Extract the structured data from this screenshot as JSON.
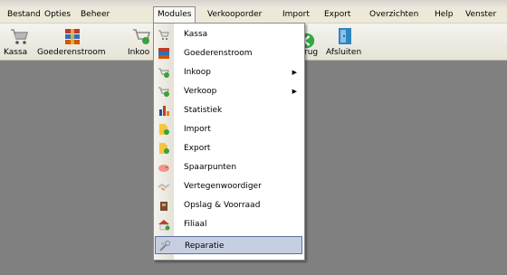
{
  "menubar": {
    "items": [
      "Bestand",
      "Opties",
      "Beheer",
      "Modules",
      "Verkooporder",
      "Import",
      "Export",
      "Overzichten",
      "Help",
      "Venster"
    ]
  },
  "toolbar": {
    "items": [
      {
        "label": "Kassa",
        "icon": "cart-icon"
      },
      {
        "label": "Goederenstroom",
        "icon": "boxes-icon"
      },
      {
        "label": "Inkoo",
        "icon": "cart-green-icon"
      },
      {
        "label": "rug",
        "icon": "back-arrow-icon"
      },
      {
        "label": "Afsluiten",
        "icon": "exit-door-icon"
      }
    ]
  },
  "modules_menu": {
    "items": [
      {
        "label": "Kassa",
        "icon": "cart-icon",
        "submenu": false
      },
      {
        "label": "Goederenstroom",
        "icon": "boxes-icon",
        "submenu": false
      },
      {
        "label": "Inkoop",
        "icon": "cart-green-icon",
        "submenu": true
      },
      {
        "label": "Verkoop",
        "icon": "cart-green-icon",
        "submenu": true
      },
      {
        "label": "Statistiek",
        "icon": "bar-chart-icon",
        "submenu": false
      },
      {
        "label": "Import",
        "icon": "import-doc-icon",
        "submenu": false
      },
      {
        "label": "Export",
        "icon": "export-doc-icon",
        "submenu": false
      },
      {
        "label": "Spaarpunten",
        "icon": "piggy-bank-icon",
        "submenu": false
      },
      {
        "label": "Vertegenwoordiger",
        "icon": "handshake-icon",
        "submenu": false
      },
      {
        "label": "Opslag & Voorraad",
        "icon": "warehouse-icon",
        "submenu": false
      },
      {
        "label": "Filiaal",
        "icon": "house-icon",
        "submenu": false
      },
      {
        "label": "Reparatie",
        "icon": "tools-icon",
        "submenu": false,
        "highlighted": true
      }
    ],
    "submenu_glyph": "▶"
  },
  "colors": {
    "workspace": "#808080",
    "menubar": "#ece9d8",
    "highlight": "#c6cfe2",
    "highlight_border": "#5c6f9e"
  }
}
